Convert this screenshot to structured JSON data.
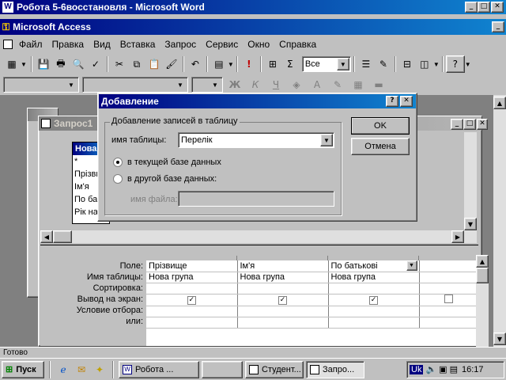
{
  "word_window": {
    "title": "Робота 5-6восстановля - Microsoft Word",
    "app_icon": "word-icon"
  },
  "access_window": {
    "title": "Microsoft Access",
    "app_icon": "access-key-icon"
  },
  "menu": [
    "Файл",
    "Правка",
    "Вид",
    "Вставка",
    "Запрос",
    "Сервис",
    "Окно",
    "Справка"
  ],
  "toolbar": {
    "query_type_value": "Все"
  },
  "query_window": {
    "title": "Запрос1"
  },
  "table_box": {
    "title": "Нова",
    "fields": [
      "*",
      "Прізви",
      "Ім'я",
      "По ба",
      "Рік на"
    ]
  },
  "dialog": {
    "title": "Добавление",
    "group_label": "Добавление записей в таблицу",
    "table_name_label": "имя таблицы:",
    "table_name_value": "Перелік",
    "radio_current": "в текущей базе данных",
    "radio_other": "в другой базе данных:",
    "file_name_label": "имя файла:",
    "ok": "OK",
    "cancel": "Отмена",
    "help": "?",
    "selected_option": "current"
  },
  "grid": {
    "row_labels": [
      "Поле:",
      "Имя таблицы:",
      "Сортировка:",
      "Вывод на экран:",
      "Условие отбора:",
      "или:"
    ],
    "columns": [
      {
        "field": "Прізвище",
        "table": "Нова група",
        "show": true
      },
      {
        "field": "Ім'я",
        "table": "Нова група",
        "show": true
      },
      {
        "field": "По батькові",
        "table": "Нова група",
        "show": true
      },
      {
        "field": "",
        "table": "",
        "show": false
      }
    ]
  },
  "status_text": "Готово",
  "taskbar": {
    "start": "Пуск",
    "tasks": [
      "Робота ...",
      "",
      "Студент...",
      "Запро..."
    ],
    "language": "Uk",
    "clock": "16:17"
  }
}
